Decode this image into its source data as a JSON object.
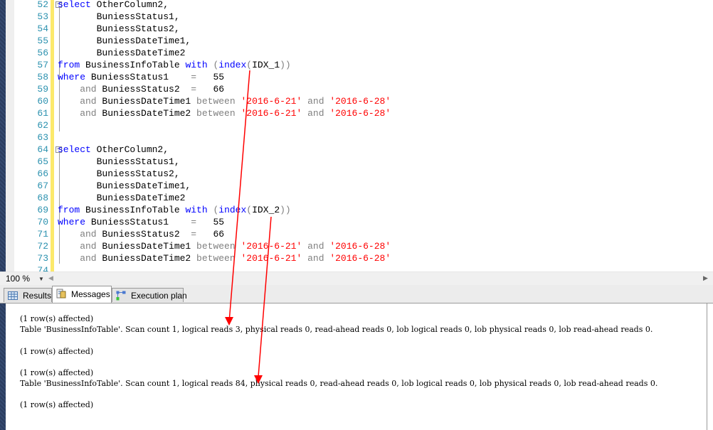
{
  "editor": {
    "lines": [
      {
        "num": "52",
        "collapse": true,
        "tokens": [
          {
            "t": "select",
            "c": "kw"
          },
          {
            "t": " OtherColumn2,",
            "c": ""
          }
        ]
      },
      {
        "num": "53",
        "tokens": [
          {
            "t": "       BuniessStatus1,",
            "c": ""
          }
        ]
      },
      {
        "num": "54",
        "tokens": [
          {
            "t": "       BuniessStatus2,",
            "c": ""
          }
        ]
      },
      {
        "num": "55",
        "tokens": [
          {
            "t": "       BuniessDateTime1,",
            "c": ""
          }
        ]
      },
      {
        "num": "56",
        "tokens": [
          {
            "t": "       BuniessDateTime2",
            "c": ""
          }
        ]
      },
      {
        "num": "57",
        "tokens": [
          {
            "t": "from",
            "c": "kw"
          },
          {
            "t": " BusinessInfoTable ",
            "c": ""
          },
          {
            "t": "with",
            "c": "kw"
          },
          {
            "t": " (",
            "c": "gr"
          },
          {
            "t": "index",
            "c": "kw"
          },
          {
            "t": "(",
            "c": "gr"
          },
          {
            "t": "IDX_1",
            "c": ""
          },
          {
            "t": "))",
            "c": "gr"
          }
        ]
      },
      {
        "num": "58",
        "tokens": [
          {
            "t": "where",
            "c": "kw"
          },
          {
            "t": " BuniessStatus1    ",
            "c": ""
          },
          {
            "t": "=",
            "c": "gr"
          },
          {
            "t": "   55",
            "c": ""
          }
        ]
      },
      {
        "num": "59",
        "tokens": [
          {
            "t": "    and",
            "c": "gr"
          },
          {
            "t": " BuniessStatus2  ",
            "c": ""
          },
          {
            "t": "=",
            "c": "gr"
          },
          {
            "t": "   66",
            "c": ""
          }
        ]
      },
      {
        "num": "60",
        "tokens": [
          {
            "t": "    and",
            "c": "gr"
          },
          {
            "t": " BuniessDateTime1 ",
            "c": ""
          },
          {
            "t": "between",
            "c": "gr"
          },
          {
            "t": " ",
            "c": ""
          },
          {
            "t": "'2016-6-21'",
            "c": "str"
          },
          {
            "t": " and ",
            "c": "gr"
          },
          {
            "t": "'2016-6-28'",
            "c": "str"
          }
        ]
      },
      {
        "num": "61",
        "tokens": [
          {
            "t": "    and",
            "c": "gr"
          },
          {
            "t": " BuniessDateTime2 ",
            "c": ""
          },
          {
            "t": "between",
            "c": "gr"
          },
          {
            "t": " ",
            "c": ""
          },
          {
            "t": "'2016-6-21'",
            "c": "str"
          },
          {
            "t": " and ",
            "c": "gr"
          },
          {
            "t": "'2016-6-28'",
            "c": "str"
          }
        ]
      },
      {
        "num": "62",
        "tokens": []
      },
      {
        "num": "63",
        "tokens": []
      },
      {
        "num": "64",
        "collapse": true,
        "tokens": [
          {
            "t": "select",
            "c": "kw"
          },
          {
            "t": " OtherColumn2,",
            "c": ""
          }
        ]
      },
      {
        "num": "65",
        "tokens": [
          {
            "t": "       BuniessStatus1,",
            "c": ""
          }
        ]
      },
      {
        "num": "66",
        "tokens": [
          {
            "t": "       BuniessStatus2,",
            "c": ""
          }
        ]
      },
      {
        "num": "67",
        "tokens": [
          {
            "t": "       BuniessDateTime1,",
            "c": ""
          }
        ]
      },
      {
        "num": "68",
        "tokens": [
          {
            "t": "       BuniessDateTime2",
            "c": ""
          }
        ]
      },
      {
        "num": "69",
        "tokens": [
          {
            "t": "from",
            "c": "kw"
          },
          {
            "t": " BusinessInfoTable ",
            "c": ""
          },
          {
            "t": "with",
            "c": "kw"
          },
          {
            "t": " (",
            "c": "gr"
          },
          {
            "t": "index",
            "c": "kw"
          },
          {
            "t": "(",
            "c": "gr"
          },
          {
            "t": "IDX_2",
            "c": ""
          },
          {
            "t": "))",
            "c": "gr"
          }
        ]
      },
      {
        "num": "70",
        "tokens": [
          {
            "t": "where",
            "c": "kw"
          },
          {
            "t": " BuniessStatus1    ",
            "c": ""
          },
          {
            "t": "=",
            "c": "gr"
          },
          {
            "t": "   55",
            "c": ""
          }
        ]
      },
      {
        "num": "71",
        "tokens": [
          {
            "t": "    and",
            "c": "gr"
          },
          {
            "t": " BuniessStatus2  ",
            "c": ""
          },
          {
            "t": "=",
            "c": "gr"
          },
          {
            "t": "   66",
            "c": ""
          }
        ]
      },
      {
        "num": "72",
        "tokens": [
          {
            "t": "    and",
            "c": "gr"
          },
          {
            "t": " BuniessDateTime1 ",
            "c": ""
          },
          {
            "t": "between",
            "c": "gr"
          },
          {
            "t": " ",
            "c": ""
          },
          {
            "t": "'2016-6-21'",
            "c": "str"
          },
          {
            "t": " and ",
            "c": "gr"
          },
          {
            "t": "'2016-6-28'",
            "c": "str"
          }
        ]
      },
      {
        "num": "73",
        "tokens": [
          {
            "t": "    and",
            "c": "gr"
          },
          {
            "t": " BuniessDateTime2 ",
            "c": ""
          },
          {
            "t": "between",
            "c": "gr"
          },
          {
            "t": " ",
            "c": ""
          },
          {
            "t": "'2016-6-21'",
            "c": "str"
          },
          {
            "t": " and ",
            "c": "gr"
          },
          {
            "t": "'2016-6-28'",
            "c": "str"
          }
        ]
      },
      {
        "num": "74",
        "tokens": []
      }
    ]
  },
  "zoom": {
    "value": "100 %"
  },
  "tabs": [
    {
      "label": "Results",
      "icon": "grid-icon",
      "active": false
    },
    {
      "label": "Messages",
      "icon": "messages-icon",
      "active": true
    },
    {
      "label": "Execution plan",
      "icon": "execution-plan-icon",
      "active": false
    }
  ],
  "messages": [
    "(1 row(s) affected)",
    "Table 'BusinessInfoTable'. Scan count 1, logical reads 3, physical reads 0, read-ahead reads 0, lob logical reads 0, lob physical reads 0, lob read-ahead reads 0.",
    "",
    "(1 row(s) affected)",
    "",
    "(1 row(s) affected)",
    "Table 'BusinessInfoTable'. Scan count 1, logical reads 84, physical reads 0, read-ahead reads 0, lob logical reads 0, lob physical reads 0, lob read-ahead reads 0.",
    "",
    "(1 row(s) affected)"
  ],
  "annotation": {
    "arrow_color": "#ff0000"
  },
  "colors": {
    "keyword": "#0000ff",
    "string": "#ff0000",
    "operator": "#808080",
    "line_number": "#2b91af"
  }
}
